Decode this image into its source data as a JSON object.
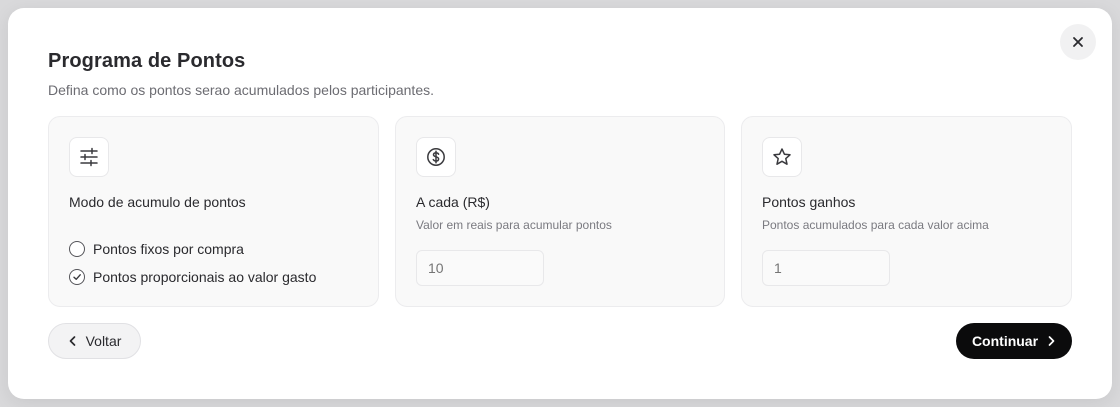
{
  "modal": {
    "title": "Programa de Pontos",
    "subtitle": "Defina como os pontos serao acumulados pelos participantes.",
    "close_icon": "close-icon"
  },
  "cards": {
    "mode": {
      "icon": "sliders-icon",
      "title": "Modo de acumulo de pontos",
      "options": [
        {
          "label": "Pontos fixos por compra",
          "selected": false
        },
        {
          "label": "Pontos proporcionais ao valor gasto",
          "selected": true
        }
      ]
    },
    "amount": {
      "icon": "dollar-circle-icon",
      "title": "A cada (R$)",
      "description": "Valor em reais para acumular pontos",
      "placeholder": "10"
    },
    "points": {
      "icon": "star-icon",
      "title": "Pontos ganhos",
      "description": "Pontos acumulados para cada valor acima",
      "placeholder": "1"
    }
  },
  "footer": {
    "back_label": "Voltar",
    "next_label": "Continuar"
  },
  "colors": {
    "primary_button": "#0b0b0c",
    "card_background": "#f9f9f9",
    "muted_text": "#7a7a80"
  }
}
